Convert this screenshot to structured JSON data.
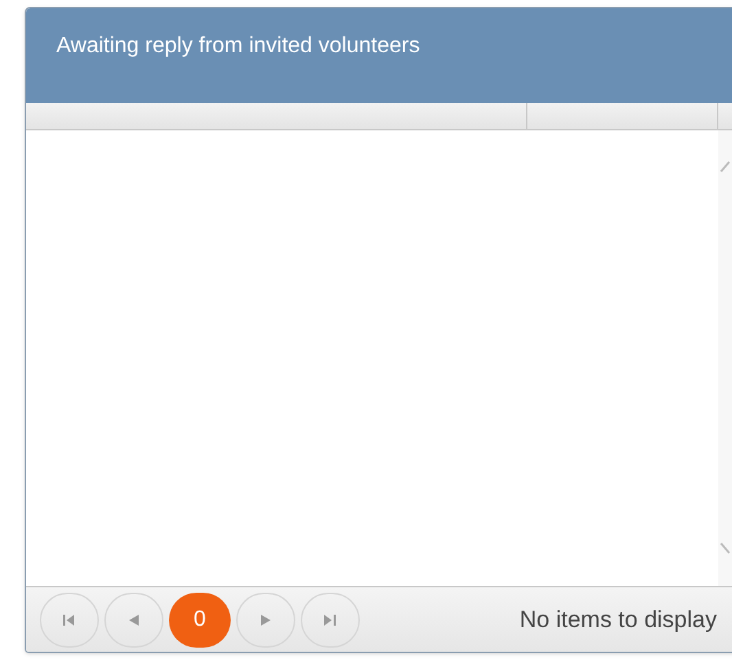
{
  "panel": {
    "title": "Awaiting reply from invited volunteers"
  },
  "pager": {
    "pages": [
      {
        "label": "0",
        "selected": true
      }
    ],
    "info": "No items to display"
  }
}
